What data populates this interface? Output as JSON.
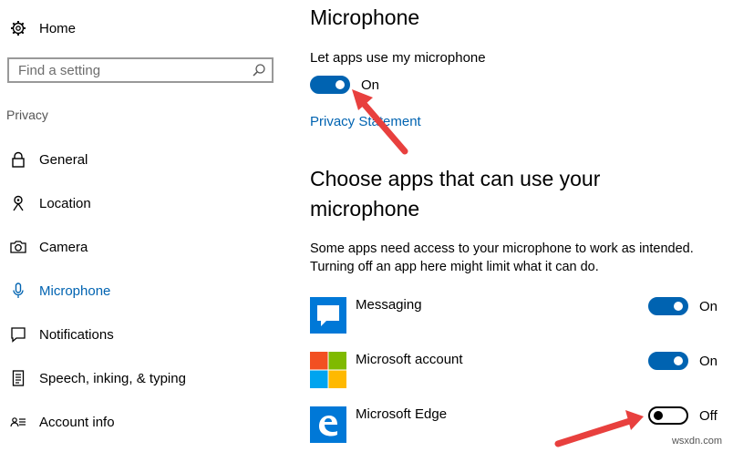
{
  "sidebar": {
    "home_label": "Home",
    "search_placeholder": "Find a setting",
    "section_label": "Privacy",
    "items": [
      {
        "label": "General",
        "icon": "lock-icon"
      },
      {
        "label": "Location",
        "icon": "location-pin-icon"
      },
      {
        "label": "Camera",
        "icon": "camera-icon"
      },
      {
        "label": "Microphone",
        "icon": "microphone-icon",
        "active": true
      },
      {
        "label": "Notifications",
        "icon": "notifications-icon"
      },
      {
        "label": "Speech, inking, & typing",
        "icon": "speech-document-icon"
      },
      {
        "label": "Account info",
        "icon": "account-info-icon"
      }
    ]
  },
  "main": {
    "title": "Microphone",
    "master_label": "Let apps use my microphone",
    "master_state": "On",
    "privacy_link": "Privacy Statement",
    "choose_heading": "Choose apps that can use your microphone",
    "description": "Some apps need access to your microphone to work as intended. Turning off an app here might limit what it can do.",
    "apps": [
      {
        "name": "Messaging",
        "state": "On",
        "icon": "messaging-icon"
      },
      {
        "name": "Microsoft account",
        "state": "On",
        "icon": "microsoft-logo-icon"
      },
      {
        "name": "Microsoft Edge",
        "state": "Off",
        "icon": "edge-icon"
      }
    ]
  },
  "colors": {
    "accent": "#0063b1",
    "annotation_arrow": "#e8403e",
    "ms_red": "#f25022",
    "ms_green": "#7fba00",
    "ms_blue": "#00a4ef",
    "ms_yellow": "#ffb900"
  },
  "watermark": "wsxdn.com"
}
